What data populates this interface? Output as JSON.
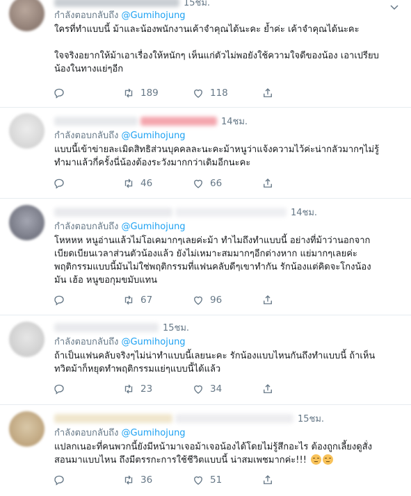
{
  "reply_prefix": "กำลังตอบกลับถึง",
  "colors": {
    "accent": "#1da1f2",
    "secondary_text": "#657786",
    "divider": "#e6ecf0"
  },
  "tweets": [
    {
      "time": "15ชม.",
      "mention": "@Gumihojung",
      "lines": [
        "ใครที่ทำแบบนี้ ม้าและน้องพนักงานเค้าจำคุณได้นะคะ ย้ำค่ะ เค้าจำคุณได้นะคะ",
        "",
        "ใจจริงอยากให้ม้าเอาเรื่องให้หนักๆ เห็นแก่ตัวไม่พอยังใช้ความใจดีของน้อง เอาเปรียบ",
        "น้องในทางแย่ๆอีก"
      ],
      "replies": "",
      "retweets": "189",
      "likes": "118"
    },
    {
      "time": "14ชม.",
      "mention": "@Gumihojung",
      "lines": [
        "แบบนี้เข้าข่ายละเมิดสิทธิส่วนบุคคลละนะคะม้าหนูว่าแจ้งความไว้ค่ะน่ากลัวมากๆไม่รู้",
        "ทำมาแล้วกี่ครั้งนี่น้องต้องระวังมากกว่าเดิมอีกนะคะ"
      ],
      "replies": "",
      "retweets": "46",
      "likes": "66"
    },
    {
      "time": "14ชม.",
      "mention": "@Gumihojung",
      "lines": [
        "โหหหห หนูอ่านแล้วไม่โอเคมากๆเลยค่ะม้า ทำไมถึงทำแบบนี้ อย่างที่ม้าว่านอกจาก",
        "เบียดเบียนเวลาส่วนตัวน้องแล้ว ยังไม่เหมาะสมมากๆอีกต่างหาก แย่มากๆเลยค่ะ",
        "พฤติกรรมแบบนี้มันไม่ใช่พฤติกรรมที่แฟนคลับดีๆเขาทำกัน รักน้องแต่คิดจะโกงน้อง",
        "มัน เฮ้อ หนูขอกุมขมับแทน"
      ],
      "replies": "",
      "retweets": "67",
      "likes": "96"
    },
    {
      "time": "15ชม.",
      "mention": "@Gumihojung",
      "lines": [
        "ถ้าเป็นแฟนคลับจริงๆไม่น่าทำแบบนี้เลยนะคะ รักน้องแบบไหนกันถึงทำแบบนี้ ถ้าเห็น",
        "ทวิตม้าก็หยุดทำพฤติกรรมแย่ๆแบบนี้ได้แล้ว"
      ],
      "replies": "",
      "retweets": "23",
      "likes": "34"
    },
    {
      "time": "15ชม.",
      "mention": "@Gumihojung",
      "lines": [
        "แปลกเนอะที่คนพวกนี้ยังมีหน้ามาเจอม้าเจอน้องได้โดยไม่รู้สึกอะไร ต้องถูกเลี้ยงดูสั่ง",
        "สอนมาแบบไหน ถึงมีตรรกะการใช้ชีวิตแบบนี้ น่าสมเพชมากค่ะ!!!"
      ],
      "replies": "",
      "retweets": "36",
      "likes": "51"
    }
  ]
}
